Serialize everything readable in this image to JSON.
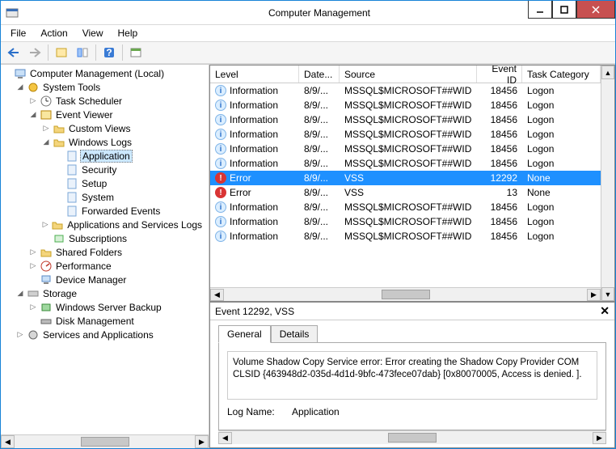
{
  "window": {
    "title": "Computer Management"
  },
  "menu": {
    "file": "File",
    "action": "Action",
    "view": "View",
    "help": "Help"
  },
  "tree": {
    "root": "Computer Management (Local)",
    "system_tools": "System Tools",
    "task_scheduler": "Task Scheduler",
    "event_viewer": "Event Viewer",
    "custom_views": "Custom Views",
    "windows_logs": "Windows Logs",
    "application": "Application",
    "security": "Security",
    "setup": "Setup",
    "system": "System",
    "forwarded": "Forwarded Events",
    "app_services": "Applications and Services Logs",
    "subscriptions": "Subscriptions",
    "shared_folders": "Shared Folders",
    "performance": "Performance",
    "device_manager": "Device Manager",
    "storage": "Storage",
    "server_backup": "Windows Server Backup",
    "disk_mgmt": "Disk Management",
    "services_apps": "Services and Applications"
  },
  "columns": {
    "level": "Level",
    "date": "Date...",
    "source": "Source",
    "event_id": "Event ID",
    "task_cat": "Task Category"
  },
  "events": [
    {
      "level": "Information",
      "icon": "info",
      "date": "8/9/...",
      "source": "MSSQL$MICROSOFT##WID",
      "event_id": "18456",
      "cat": "Logon"
    },
    {
      "level": "Information",
      "icon": "info",
      "date": "8/9/...",
      "source": "MSSQL$MICROSOFT##WID",
      "event_id": "18456",
      "cat": "Logon"
    },
    {
      "level": "Information",
      "icon": "info",
      "date": "8/9/...",
      "source": "MSSQL$MICROSOFT##WID",
      "event_id": "18456",
      "cat": "Logon"
    },
    {
      "level": "Information",
      "icon": "info",
      "date": "8/9/...",
      "source": "MSSQL$MICROSOFT##WID",
      "event_id": "18456",
      "cat": "Logon"
    },
    {
      "level": "Information",
      "icon": "info",
      "date": "8/9/...",
      "source": "MSSQL$MICROSOFT##WID",
      "event_id": "18456",
      "cat": "Logon"
    },
    {
      "level": "Information",
      "icon": "info",
      "date": "8/9/...",
      "source": "MSSQL$MICROSOFT##WID",
      "event_id": "18456",
      "cat": "Logon"
    },
    {
      "level": "Error",
      "icon": "error",
      "date": "8/9/...",
      "source": "VSS",
      "event_id": "12292",
      "cat": "None",
      "selected": true
    },
    {
      "level": "Error",
      "icon": "error",
      "date": "8/9/...",
      "source": "VSS",
      "event_id": "13",
      "cat": "None"
    },
    {
      "level": "Information",
      "icon": "info",
      "date": "8/9/...",
      "source": "MSSQL$MICROSOFT##WID",
      "event_id": "18456",
      "cat": "Logon"
    },
    {
      "level": "Information",
      "icon": "info",
      "date": "8/9/...",
      "source": "MSSQL$MICROSOFT##WID",
      "event_id": "18456",
      "cat": "Logon"
    },
    {
      "level": "Information",
      "icon": "info",
      "date": "8/9/...",
      "source": "MSSQL$MICROSOFT##WID",
      "event_id": "18456",
      "cat": "Logon"
    }
  ],
  "detail": {
    "title": "Event 12292, VSS",
    "tab_general": "General",
    "tab_details": "Details",
    "message": "Volume Shadow Copy Service error: Error creating the Shadow Copy Provider COM\nCLSID {463948d2-035d-4d1d-9bfc-473fece07dab} [0x80070005, Access is denied.\n].",
    "log_name_label": "Log Name:",
    "log_name_value": "Application"
  }
}
